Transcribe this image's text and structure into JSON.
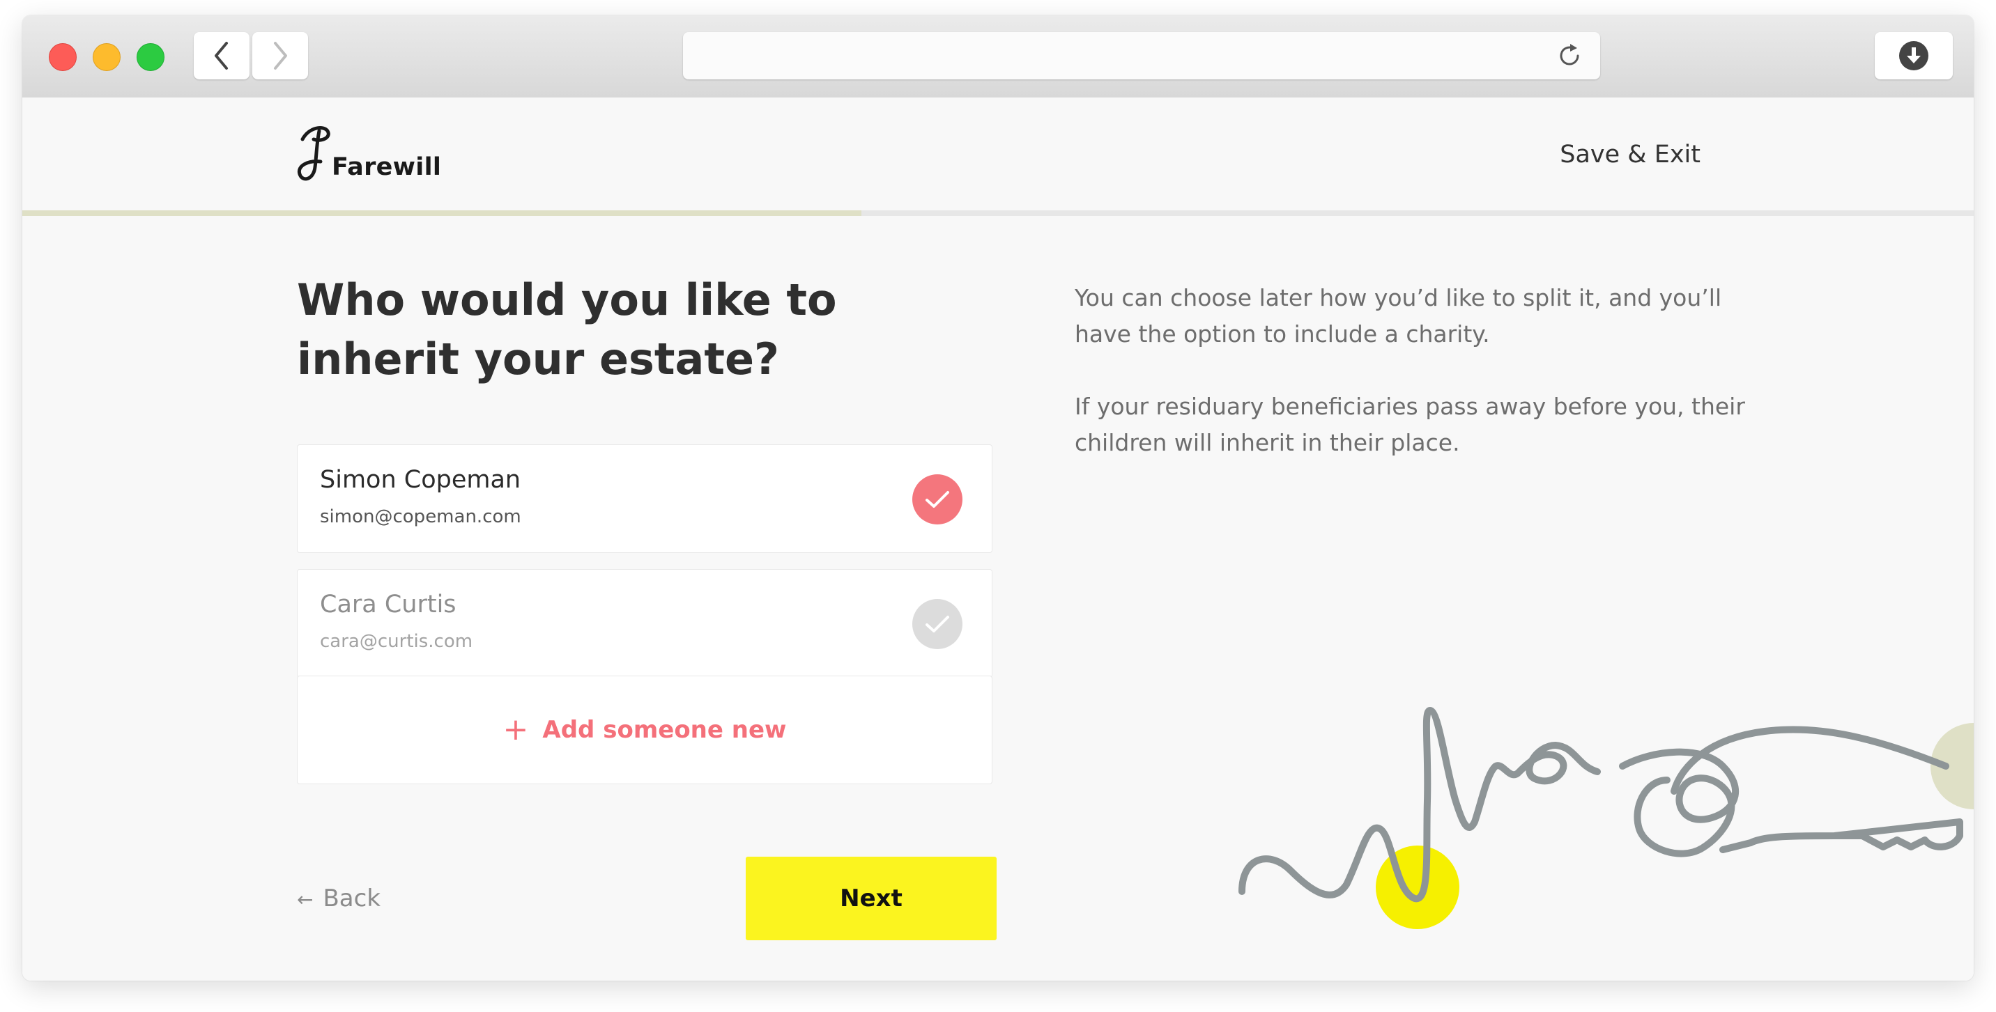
{
  "browser": {
    "back_icon": "chevron-left-icon",
    "forward_icon": "chevron-right-icon",
    "reload_icon": "reload-icon",
    "download_icon": "download-icon",
    "url": ""
  },
  "header": {
    "logo_text": "Farewill",
    "save_exit_label": "Save & Exit"
  },
  "progress": {
    "fraction": 0.43
  },
  "main": {
    "heading": "Who would you like to inherit your estate?",
    "people": [
      {
        "name": "Simon Copeman",
        "email": "simon@copeman.com",
        "selected": true
      },
      {
        "name": "Cara Curtis",
        "email": "cara@curtis.com",
        "selected": false
      }
    ],
    "add_label": "Add someone new",
    "back_label": "Back",
    "next_label": "Next"
  },
  "info": {
    "paragraph1": "You can choose later how you’d like to split it, and you’ll have the option to include a charity.",
    "paragraph2": "If your residuary beneficiaries pass away before you, their children will inherit in their place."
  },
  "colors": {
    "accent_pink": "#f4767d",
    "accent_yellow": "#fbf41f",
    "progress_fill": "#dfe0c6",
    "illustration_line": "#8e9597"
  }
}
